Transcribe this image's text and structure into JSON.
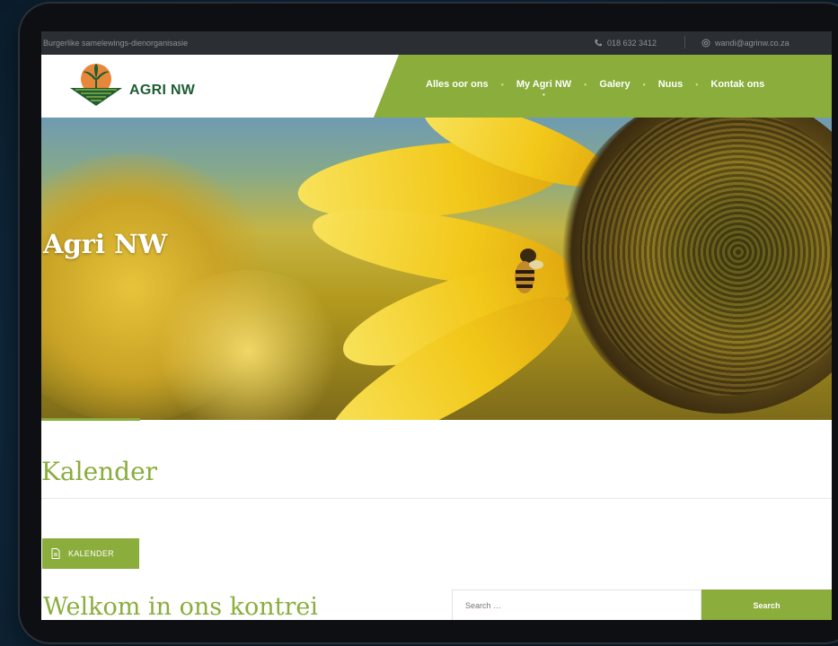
{
  "topbar": {
    "tagline": "Burgerlike samelewings-dienorganisasie",
    "phone": "018 632 3412",
    "email": "wandi@agrinw.co.za"
  },
  "logo": {
    "text": "AGRI NW"
  },
  "nav": {
    "items": [
      "Alles oor ons",
      "My Agri NW",
      "Galery",
      "Nuus",
      "Kontak ons"
    ]
  },
  "hero": {
    "title": "Agri NW"
  },
  "content": {
    "section_title": "Kalender",
    "button_label": "KALENDER",
    "welcome": "Welkom in ons kontrei"
  },
  "search": {
    "placeholder": "Search …",
    "button_label": "Search"
  },
  "colors": {
    "accent": "#8aad3c",
    "logo_green": "#1e5d33",
    "topbar": "#2b2e33"
  }
}
